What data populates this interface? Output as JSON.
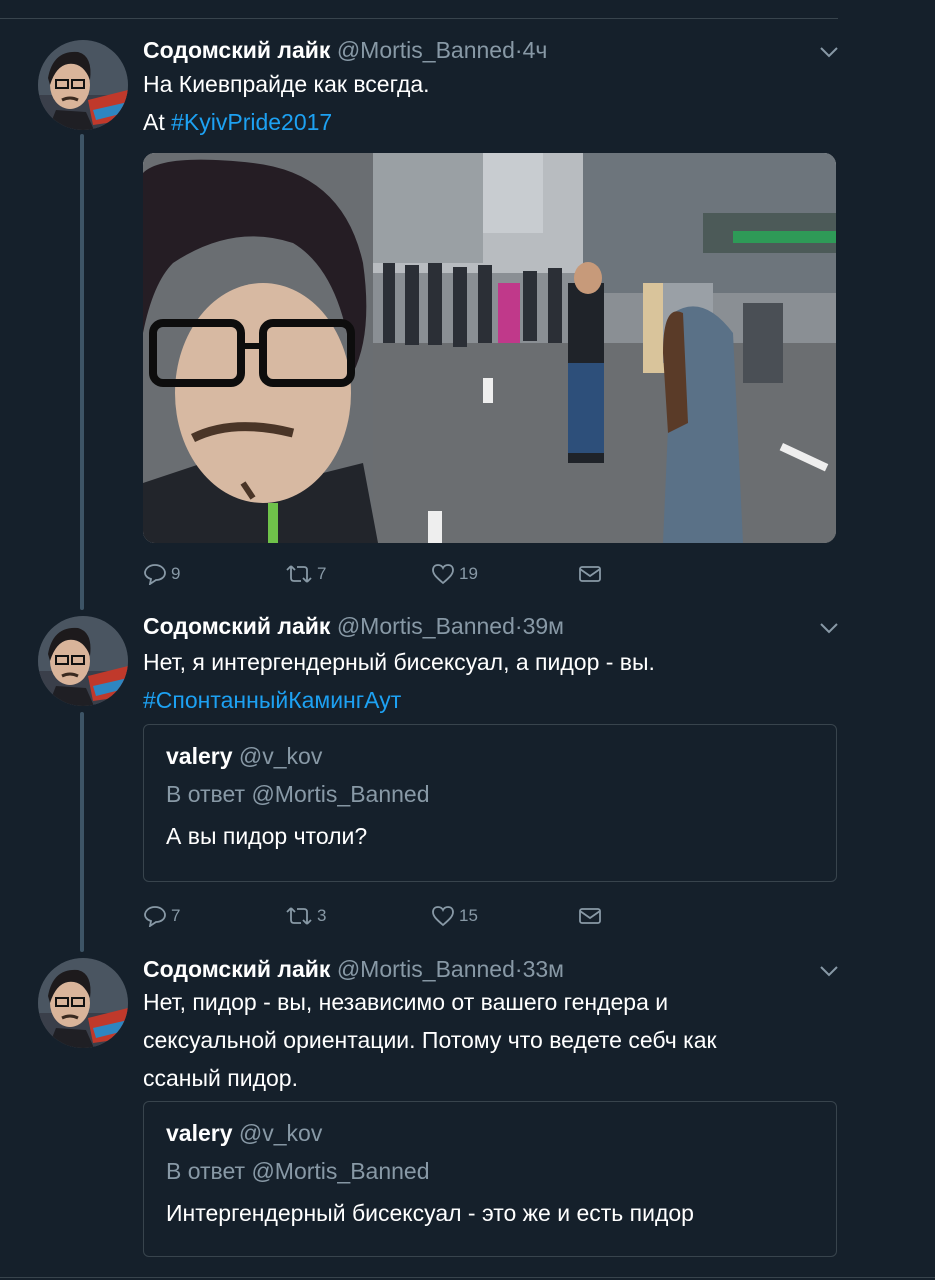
{
  "tweets": [
    {
      "author_name": "Содомский лайк",
      "author_handle": "@Mortis_Banned",
      "separator": "·",
      "time": "4ч",
      "text_line1": "На Киевпрайде как всегда.",
      "text_line2_prefix": "At ",
      "hashtag": "#KyivPride2017",
      "replies": "9",
      "retweets": "7",
      "likes": "19"
    },
    {
      "author_name": "Содомский лайк",
      "author_handle": "@Mortis_Banned",
      "separator": "·",
      "time": "39м",
      "text_line1": "Нет, я интергендерный бисексуал, а пидор - вы.",
      "hashtag": "#СпонтанныйКамингАут",
      "quote": {
        "name": "valery",
        "handle": "@v_kov",
        "reply_to": "В ответ @Mortis_Banned",
        "text": "А вы пидор чтоли?"
      },
      "replies": "7",
      "retweets": "3",
      "likes": "15"
    },
    {
      "author_name": "Содомский лайк",
      "author_handle": "@Mortis_Banned",
      "separator": "·",
      "time": "33м",
      "text_line1": "Нет, пидор - вы, независимо от вашего гендера и",
      "text_line2": "сексуальной ориентации. Потому что ведете себч как",
      "text_line3": "ссаный пидор.",
      "quote": {
        "name": "valery",
        "handle": "@v_kov",
        "reply_to": "В ответ @Mortis_Banned",
        "text": "Интергендерный бисексуал - это же и есть пидор"
      }
    }
  ],
  "colors": {
    "background": "#15202b",
    "text": "#ffffff",
    "secondary": "#8899a6",
    "accent": "#1da1f2",
    "border": "#38444d",
    "thread_line": "#3d5466"
  },
  "icons": {
    "reply": "reply-icon",
    "retweet": "retweet-icon",
    "like": "heart-icon",
    "message": "envelope-icon",
    "caret": "chevron-down-icon"
  }
}
